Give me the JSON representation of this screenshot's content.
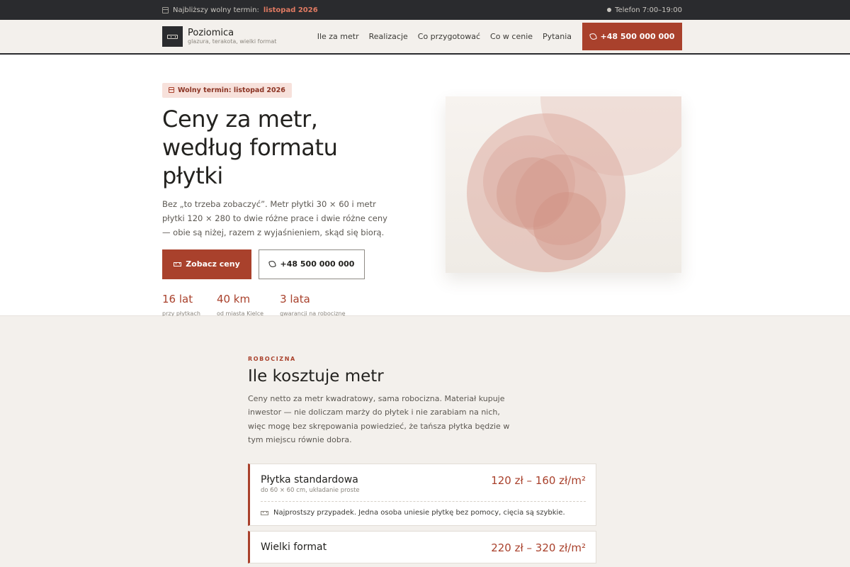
{
  "topbar": {
    "next_term_label": "Najbliższy wolny termin:",
    "next_term_value": "listopad 2026",
    "phone_hours": "Telefon 7:00–19:00"
  },
  "brand": {
    "name": "Poziomica",
    "tagline": "glazura, terakota, wielki format"
  },
  "nav": {
    "items": [
      "Ile za metr",
      "Realizacje",
      "Co przygotować",
      "Co w cenie",
      "Pytania"
    ],
    "cta_phone": "+48 500 000 000"
  },
  "hero": {
    "badge": "Wolny termin: listopad 2026",
    "title": "Ceny za metr, według formatu płytki",
    "lead": "Bez „to trzeba zobaczyć”. Metr płytki 30 × 60 i metr płytki 120 × 280 to dwie różne prace i dwie różne ceny — obie są niżej, razem z wyjaśnieniem, skąd się biorą.",
    "primary_button": "Zobacz ceny",
    "secondary_button": "+48 500 000 000",
    "stats": [
      {
        "value": "16 lat",
        "label": "przy płytkach"
      },
      {
        "value": "40 km",
        "label": "od miasta Kielce"
      },
      {
        "value": "3 lata",
        "label": "gwarancji na robociznę"
      }
    ]
  },
  "pricing": {
    "eyebrow": "ROBOCIZNA",
    "title": "Ile kosztuje metr",
    "lead": "Ceny netto za metr kwadratowy, sama robocizna. Materiał kupuje inwestor — nie doliczam marży do płytek i nie zarabiam na nich, więc mogę bez skrępowania powiedzieć, że tańsza płytka będzie w tym miejscu równie dobra.",
    "cards": [
      {
        "name": "Płytka standardowa",
        "sub": "do 60 × 60 cm, układanie proste",
        "price": "120 zł – 160 zł/m²",
        "note": "Najprostszy przypadek. Jedna osoba uniesie płytkę bez pomocy, cięcia są szybkie."
      },
      {
        "name": "Wielki format",
        "sub": "",
        "price": "220 zł – 320 zł/m²",
        "note": ""
      }
    ]
  },
  "colors": {
    "accent": "#a9412c",
    "dark": "#2a2b2e",
    "section_bg": "#f3f0ec",
    "badge_bg": "#f7e1db"
  }
}
